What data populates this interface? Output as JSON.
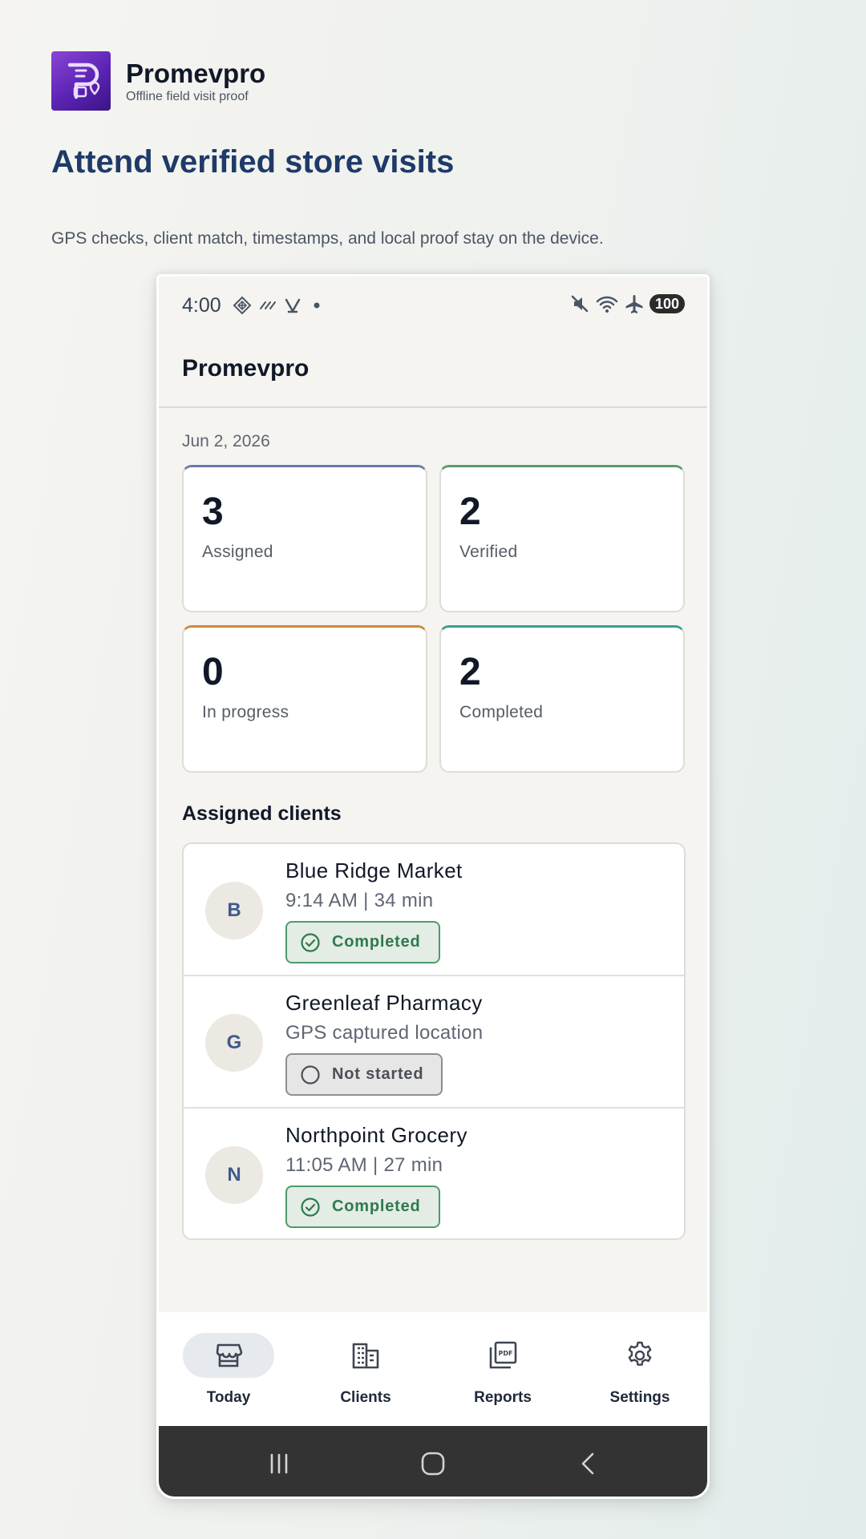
{
  "brand": {
    "name": "Promevpro",
    "subtitle": "Offline field visit proof",
    "logo_icon": "receipt-location-icon",
    "logo_colors": [
      "#8b45d8",
      "#3b1486"
    ]
  },
  "hero": {
    "headline": "Attend verified store visits",
    "tagline": "GPS checks, client match, timestamps, and local proof stay on the device."
  },
  "status_bar": {
    "time": "4:00",
    "left_icons": [
      "diamond-grid-icon",
      "slashes-icon",
      "v-logo-icon",
      "dot-icon"
    ],
    "right_icons": [
      "mute-icon",
      "wifi-icon",
      "airplane-icon"
    ],
    "battery": "100"
  },
  "app_bar": {
    "title": "Promevpro"
  },
  "date": "Jun 2, 2026",
  "stats": [
    {
      "value": "3",
      "label": "Assigned",
      "accent": "#6b7aa8"
    },
    {
      "value": "2",
      "label": "Verified",
      "accent": "#5b9a6e"
    },
    {
      "value": "0",
      "label": "In progress",
      "accent": "#cf8a3a"
    },
    {
      "value": "2",
      "label": "Completed",
      "accent": "#3f9a96"
    }
  ],
  "clients_section": {
    "title": "Assigned clients",
    "clients": [
      {
        "initial": "B",
        "name": "Blue Ridge Market",
        "detail": "9:14 AM | 34 min",
        "status": "Completed",
        "status_icon": "check-circle-icon"
      },
      {
        "initial": "G",
        "name": "Greenleaf Pharmacy",
        "detail": "GPS captured location",
        "status": "Not started",
        "status_icon": "circle-outline-icon"
      },
      {
        "initial": "N",
        "name": "Northpoint Grocery",
        "detail": "11:05 AM | 27 min",
        "status": "Completed",
        "status_icon": "check-circle-icon"
      }
    ]
  },
  "bottom_nav": {
    "items": [
      {
        "label": "Today",
        "icon": "storefront-icon",
        "active": true
      },
      {
        "label": "Clients",
        "icon": "building-icon",
        "active": false
      },
      {
        "label": "Reports",
        "icon": "pdf-icon",
        "active": false
      },
      {
        "label": "Settings",
        "icon": "gear-icon",
        "active": false
      }
    ]
  },
  "system_nav": {
    "icons": [
      "recent-apps-icon",
      "home-icon",
      "back-icon"
    ]
  },
  "colors": {
    "heading": "#1e3a68",
    "completed": "#2f7a4d",
    "not_started": "#4b4f56",
    "nav_active": "#e6eaef"
  }
}
